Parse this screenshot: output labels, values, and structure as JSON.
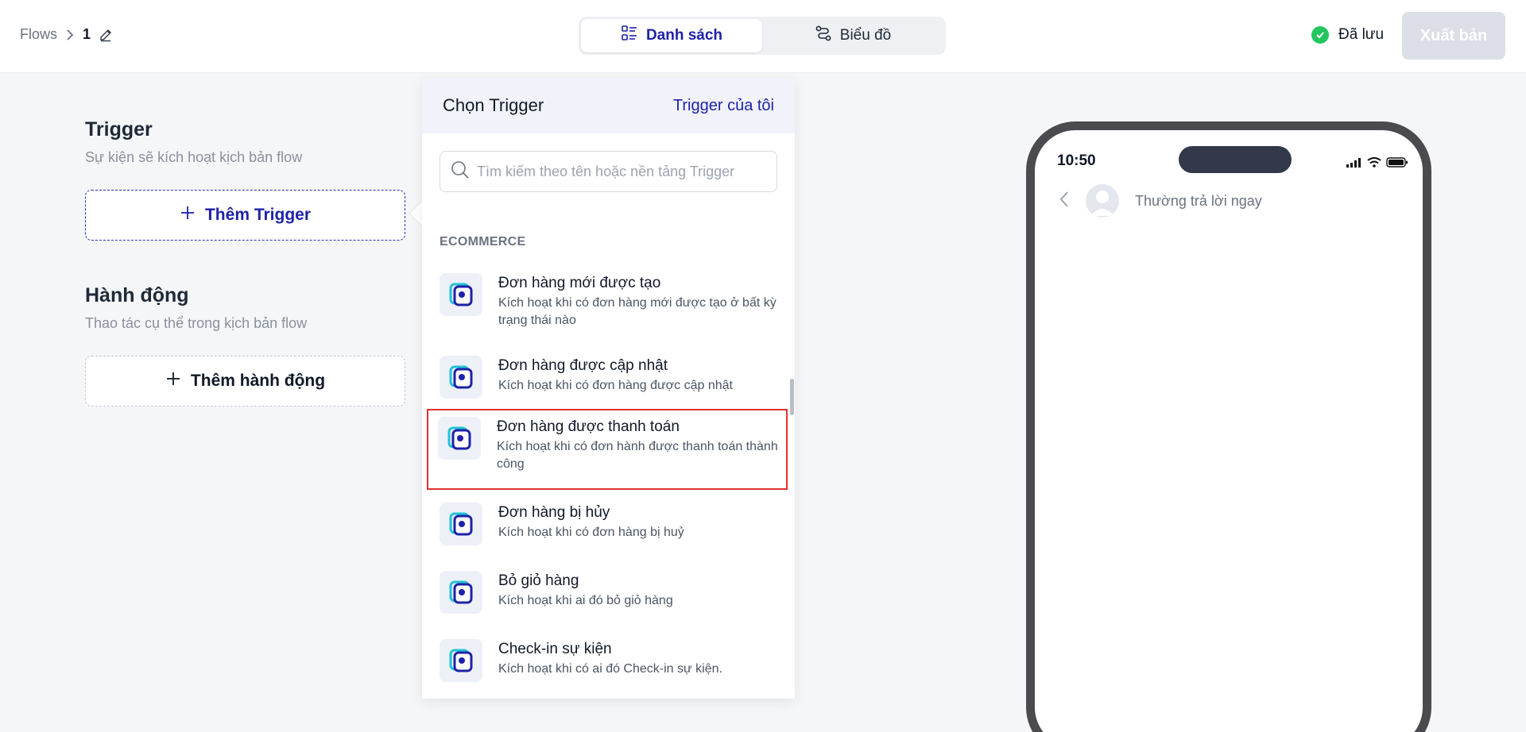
{
  "header": {
    "breadcrumb": {
      "root": "Flows",
      "current": "1"
    },
    "views": [
      {
        "label": "Danh sách",
        "active": true
      },
      {
        "label": "Biểu đồ",
        "active": false
      }
    ],
    "saved_label": "Đã lưu",
    "publish_label": "Xuất bản"
  },
  "left": {
    "trigger": {
      "title": "Trigger",
      "subtitle": "Sự kiện sẽ kích hoạt kịch bản flow",
      "add_label": "Thêm Trigger"
    },
    "action": {
      "title": "Hành động",
      "subtitle": "Thao tác cụ thể trong kịch bản flow",
      "add_label": "Thêm hành động"
    }
  },
  "panel": {
    "title": "Chọn Trigger",
    "my_triggers_link": "Trigger của tôi",
    "search_placeholder": "Tìm kiếm theo tên hoặc nền tảng Trigger",
    "group_label": "ECOMMERCE",
    "items": [
      {
        "title": "Đơn hàng mới được tạo",
        "desc": "Kích hoạt khi có đơn hàng mới được tạo ở bất kỳ trạng thái nào",
        "highlighted": false
      },
      {
        "title": "Đơn hàng được cập nhật",
        "desc": "Kích hoạt khi có đơn hàng được cập nhật",
        "highlighted": false
      },
      {
        "title": "Đơn hàng được thanh toán",
        "desc": "Kích hoạt khi có đơn hành được thanh toán thành công",
        "highlighted": true
      },
      {
        "title": "Đơn hàng bị hủy",
        "desc": "Kích hoạt khi có đơn hàng bị huỷ",
        "highlighted": false
      },
      {
        "title": "Bỏ giỏ hàng",
        "desc": "Kích hoạt khi ai đó bỏ giỏ hàng",
        "highlighted": false
      },
      {
        "title": "Check-in sự kiện",
        "desc": "Kích hoạt khi có ai đó Check-in sự kiện.",
        "highlighted": false
      }
    ]
  },
  "phone": {
    "time": "10:50",
    "chat_status": "Thường trả lời ngay"
  },
  "colors": {
    "accent": "#1e22a8",
    "success": "#22c55e",
    "highlight": "#e03131"
  }
}
